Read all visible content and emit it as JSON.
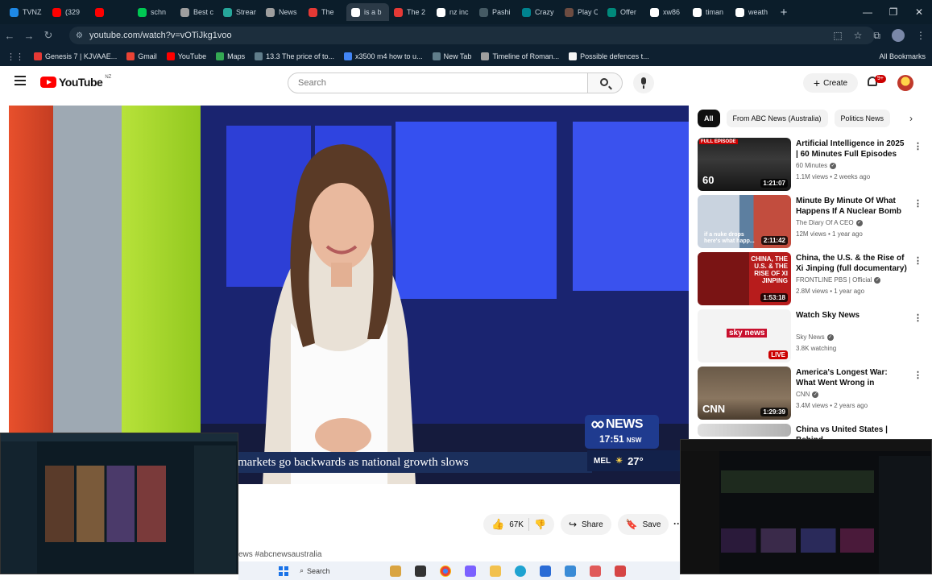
{
  "browser": {
    "tabs": [
      {
        "label": "TVNZ",
        "color": "#1e88e5",
        "active": false
      },
      {
        "label": "(329",
        "color": "#ff0000",
        "active": false
      },
      {
        "label": "",
        "color": "#ff0000",
        "active": false
      },
      {
        "label": "schn",
        "color": "#00c853",
        "active": false
      },
      {
        "label": "Best c",
        "color": "#9e9e9e",
        "active": false
      },
      {
        "label": "Stream",
        "color": "#26a69a",
        "active": false
      },
      {
        "label": "News",
        "color": "#9e9e9e",
        "active": false
      },
      {
        "label": "The",
        "color": "#e53935",
        "active": false
      },
      {
        "label": "is a b",
        "color": "#ffffff",
        "active": true
      },
      {
        "label": "The 2",
        "color": "#e53935",
        "active": false
      },
      {
        "label": "nz inc",
        "color": "#ffffff",
        "active": false
      },
      {
        "label": "Pashi",
        "color": "#455a64",
        "active": false
      },
      {
        "label": "Crazy",
        "color": "#00838f",
        "active": false
      },
      {
        "label": "Play C",
        "color": "#6d4c41",
        "active": false
      },
      {
        "label": "Offer",
        "color": "#00897b",
        "active": false
      },
      {
        "label": "xw86",
        "color": "#ffffff",
        "active": false
      },
      {
        "label": "timan",
        "color": "#ffffff",
        "active": false
      },
      {
        "label": "weath",
        "color": "#ffffff",
        "active": false
      }
    ],
    "url": "youtube.com/watch?v=vOTiJkg1voo",
    "bookmarks": [
      {
        "label": "Genesis 7 | KJVAAE...",
        "color": "#e53935"
      },
      {
        "label": "Gmail",
        "color": "#ea4335"
      },
      {
        "label": "YouTube",
        "color": "#ff0000"
      },
      {
        "label": "Maps",
        "color": "#34a853"
      },
      {
        "label": "13.3 The price of to...",
        "color": "#607d8b"
      },
      {
        "label": "x3500 m4 how to u...",
        "color": "#4285f4"
      },
      {
        "label": "New Tab",
        "color": "#607d8b"
      },
      {
        "label": "Timeline of Roman...",
        "color": "#9e9e9e"
      },
      {
        "label": "Possible defences t...",
        "color": "#f5f5f5"
      }
    ],
    "all_bookmarks_label": "All Bookmarks"
  },
  "youtube": {
    "logo_text": "YouTube",
    "country_code": "NZ",
    "search_placeholder": "Search",
    "create_label": "Create",
    "notification_count": "9+"
  },
  "video": {
    "ticker_text": "markets go backwards as national growth slows",
    "badge_news": "NEWS",
    "badge_time": "17:51",
    "badge_tz": "NSW",
    "weather_city": "MEL",
    "weather_temp": "27°",
    "like_count": "67K",
    "share_label": "Share",
    "save_label": "Save",
    "hashtag_text": "ews #abcnewsaustralia"
  },
  "sidebar": {
    "chips": [
      "All",
      "From ABC News (Australia)",
      "Politics News"
    ],
    "recommendations": [
      {
        "title": "Artificial Intelligence in 2025 | 60 Minutes Full Episodes",
        "channel": "60 Minutes",
        "meta": "1.1M views • 2 weeks ago",
        "duration": "1:21:07",
        "ribbon": "FULL EPISODE",
        "thumb_text": "60"
      },
      {
        "title": "Minute By Minute Of What Happens If A Nuclear Bomb ...",
        "channel": "The Diary Of A CEO",
        "meta": "12M views • 1 year ago",
        "duration": "2:11:42",
        "thumb_text": "if a nuke drops here's what happ..."
      },
      {
        "title": "China, the U.S. & the Rise of Xi Jinping (full documentary) | ...",
        "channel": "FRONTLINE PBS | Official",
        "meta": "2.8M views • 1 year ago",
        "duration": "1:53:18",
        "thumb_text": "CHINA, THE U.S. & THE RISE OF XI JINPING"
      },
      {
        "title": "Watch Sky News",
        "channel": "Sky News",
        "meta": "3.8K watching",
        "live": "LIVE",
        "thumb_text": "sky news"
      },
      {
        "title": "America's Longest War: What Went Wrong in Afghanistan ...",
        "channel": "CNN",
        "meta": "3.4M views • 2 years ago",
        "duration": "1:29:39",
        "thumb_text": "CNN"
      },
      {
        "title": "China vs United States | Behind",
        "channel": "",
        "meta": ""
      }
    ]
  },
  "taskbar": {
    "search_label": "Search"
  }
}
